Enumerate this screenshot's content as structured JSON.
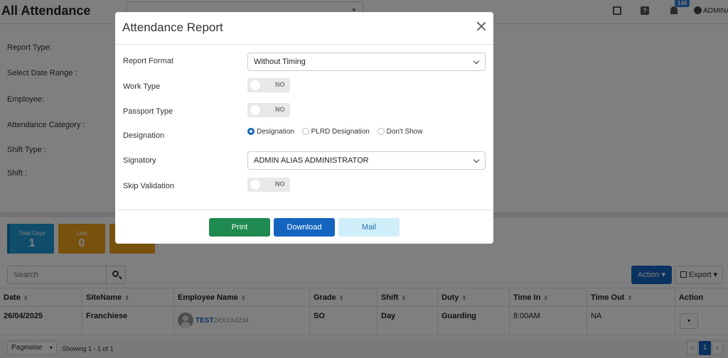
{
  "header": {
    "title": "All Attendance",
    "notification_count": "149",
    "user": "ADMINA"
  },
  "filters": {
    "labels": [
      "Report Type:",
      "Select Date Range :",
      "Employee:",
      "Attendance Category :",
      "Shift Type :",
      "Shift :"
    ]
  },
  "stats": [
    {
      "label": "Total Days",
      "value": "1",
      "color": "#1f9bd7"
    },
    {
      "label": "Late",
      "value": "0",
      "color": "#f0a21b"
    },
    {
      "label": "",
      "value": "1",
      "color": "#f0a21b"
    }
  ],
  "search": {
    "placeholder": "Search"
  },
  "toolbar": {
    "action_label": "Action",
    "export_label": "Export"
  },
  "table": {
    "columns": [
      "Date",
      "SiteName",
      "Employee Name",
      "Grade",
      "Shift",
      "Duty",
      "Time In",
      "Time Out",
      "Action"
    ],
    "rows": [
      {
        "date": "26/04/2025",
        "site": "Franchiese",
        "employee_name": "TEST",
        "employee_id": "2XXXX4234",
        "grade": "SO",
        "shift": "Day",
        "duty": "Guarding",
        "time_in": "8:00AM",
        "time_out": "NA"
      }
    ]
  },
  "footer": {
    "pagewise": "Pagewise",
    "showing": "Showing 1 - 1 of 1",
    "page": "1",
    "prev": "«",
    "next": "»"
  },
  "modal": {
    "title": "Attendance Report",
    "report_format": {
      "label": "Report Format",
      "value": "Without Timing"
    },
    "work_type": {
      "label": "Work Type",
      "value": "NO"
    },
    "passport_type": {
      "label": "Passport Type",
      "value": "NO"
    },
    "designation": {
      "label": "Designation",
      "options": [
        "Designation",
        "PLRD Designation",
        "Don't Show"
      ],
      "selected": "Designation"
    },
    "signatory": {
      "label": "Signatory",
      "value": "ADMIN ALIAS ADMINISTRATOR"
    },
    "skip_validation": {
      "label": "Skip Validation",
      "value": "NO"
    },
    "buttons": {
      "print": "Print",
      "download": "Download",
      "mail": "Mail"
    }
  },
  "colors": {
    "primary": "#1565c0",
    "success": "#1e8a4f",
    "info_light": "#cfeefa",
    "warning": "#f0a21b"
  }
}
